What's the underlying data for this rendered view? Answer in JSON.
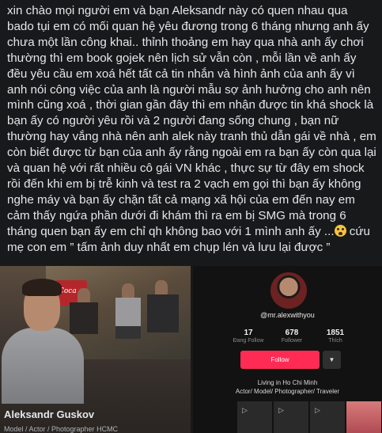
{
  "post": {
    "text": "xin chào mọi người em và bạn Aleksandr này có quen nhau qua bado tụi em có mối quan hệ yêu đương trong 6 tháng nhưng anh ấy chưa một lần công khai.. thỉnh thoảng em hay qua nhà anh ấy chơi thường thì em book gojek nên lịch sử vẫn còn , mỗi lần về anh ấy đều yêu cầu em xoá hết tất cả tin nhắn và hình ảnh của anh ấy vì anh nói công việc của anh là người mẫu sợ ảnh hưởng cho anh nên mình cũng xoá , thời gian gần đây thì em nhận được tin khá shock là bạn ấy có người yêu rồi và 2 người đang sống chung , bạn nữ thường hay vắng nhà nên anh alek này tranh thủ dẫn gái về nhà , em còn biết được từ bạn của anh ấy rằng ngoài em ra bạn ấy còn qua lại và quan hệ với rất nhiều cô gái VN khác , thực sự từ đây em shock rồi đến khi em bị trễ kinh và test ra 2 vạch em gọi thì bạn ấy không nghe máy và bạn ấy chặn tất cả mạng xã hội của em đến nay em cảm thấy ngứa phần dưới đi khám thì ra em bị SMG mà trong 6 tháng quen bạn ấy em chỉ qh không bao với 1 mình anh ấy ...",
    "text_after_emoji": " cứu mẹ con em ” tấm ảnh duy nhất em chụp lén và lưu lại được ”",
    "emoji": "fearful-face-emoji"
  },
  "left_card": {
    "sign_text": "Coca",
    "name": "Aleksandr Guskov",
    "subtitle": "Model / Actor / Photographer HCMC"
  },
  "right_card": {
    "handle": "@mr.alexwithyou",
    "stats": [
      {
        "value": "17",
        "label": "Đang Follow"
      },
      {
        "value": "678",
        "label": "Follower"
      },
      {
        "value": "1851",
        "label": "Thích"
      }
    ],
    "follow_label": "Follow",
    "dropdown_icon": "caret-down-icon",
    "bio_line1": "Living in Ho Chi Minh",
    "bio_line2": "Actor/ Model/ Photographer/ Traveler"
  },
  "colors": {
    "background": "#18191a",
    "follow": "#fe2c55"
  }
}
